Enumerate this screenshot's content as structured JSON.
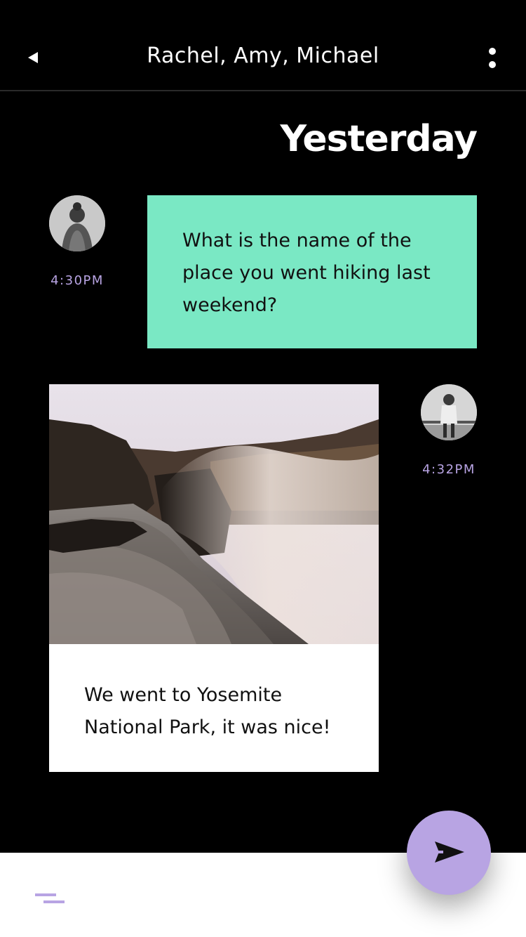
{
  "header": {
    "title": "Rachel, Amy, Michael",
    "back_icon": "back-triangle-icon",
    "more_icon": "more-vertical-icon"
  },
  "day_separator": "Yesterday",
  "messages": [
    {
      "sender_avatar": "avatar-icon",
      "time": "4:30PM",
      "text": "What is the name of the place you went hiking last weekend?",
      "bubble_color": "#7ae8c4"
    },
    {
      "sender_avatar": "avatar-icon",
      "time": "4:32PM",
      "image": "waterfall-photo",
      "text": "We went to Yosemite National Park, it was nice!",
      "bubble_color": "#ffffff"
    }
  ],
  "composer": {
    "menu_icon": "menu-icon",
    "send_icon": "send-icon"
  },
  "colors": {
    "background": "#000000",
    "accent": "#b8a4e3",
    "mint": "#7ae8c4"
  }
}
